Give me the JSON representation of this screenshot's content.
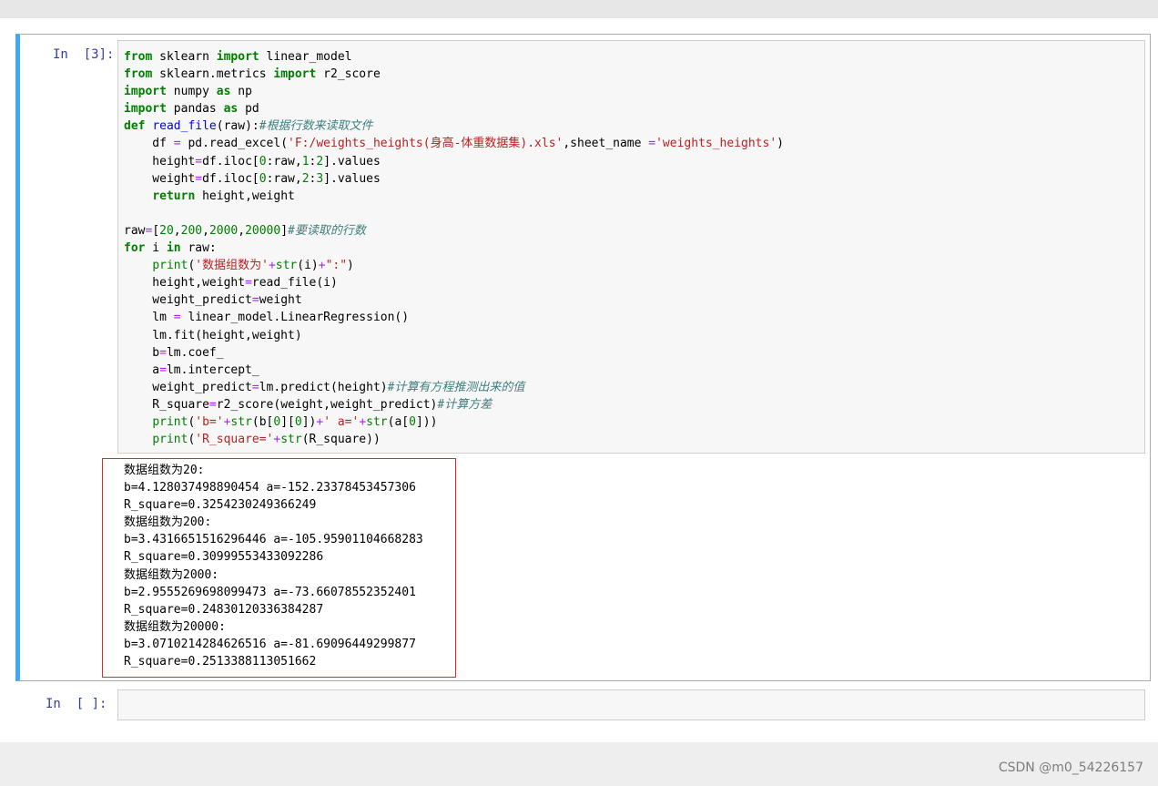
{
  "cell1": {
    "prompt": "In  [3]:",
    "code_lines": [
      [
        {
          "t": "kw",
          "v": "from"
        },
        {
          "t": "",
          "v": " sklearn "
        },
        {
          "t": "kw",
          "v": "import"
        },
        {
          "t": "",
          "v": " linear_model"
        }
      ],
      [
        {
          "t": "kw",
          "v": "from"
        },
        {
          "t": "",
          "v": " sklearn.metrics "
        },
        {
          "t": "kw",
          "v": "import"
        },
        {
          "t": "",
          "v": " r2_score"
        }
      ],
      [
        {
          "t": "kw",
          "v": "import"
        },
        {
          "t": "",
          "v": " numpy "
        },
        {
          "t": "kw",
          "v": "as"
        },
        {
          "t": "",
          "v": " np"
        }
      ],
      [
        {
          "t": "kw",
          "v": "import"
        },
        {
          "t": "",
          "v": " pandas "
        },
        {
          "t": "kw",
          "v": "as"
        },
        {
          "t": "",
          "v": " pd"
        }
      ],
      [
        {
          "t": "kw",
          "v": "def"
        },
        {
          "t": "",
          "v": " "
        },
        {
          "t": "fn",
          "v": "read_file"
        },
        {
          "t": "",
          "v": "(raw):"
        },
        {
          "t": "cm",
          "v": "#根据行数来读取文件"
        }
      ],
      [
        {
          "t": "",
          "v": "    df "
        },
        {
          "t": "op",
          "v": "="
        },
        {
          "t": "",
          "v": " pd.read_excel("
        },
        {
          "t": "str",
          "v": "'F:/weights_heights(身高-体重数据集).xls'"
        },
        {
          "t": "",
          "v": ",sheet_name "
        },
        {
          "t": "op",
          "v": "="
        },
        {
          "t": "str",
          "v": "'weights_heights'"
        },
        {
          "t": "",
          "v": ")"
        }
      ],
      [
        {
          "t": "",
          "v": "    height"
        },
        {
          "t": "op",
          "v": "="
        },
        {
          "t": "",
          "v": "df.iloc["
        },
        {
          "t": "num",
          "v": "0"
        },
        {
          "t": "",
          "v": ":raw,"
        },
        {
          "t": "num",
          "v": "1"
        },
        {
          "t": "",
          "v": ":"
        },
        {
          "t": "num",
          "v": "2"
        },
        {
          "t": "",
          "v": "].values"
        }
      ],
      [
        {
          "t": "",
          "v": "    weight"
        },
        {
          "t": "op",
          "v": "="
        },
        {
          "t": "",
          "v": "df.iloc["
        },
        {
          "t": "num",
          "v": "0"
        },
        {
          "t": "",
          "v": ":raw,"
        },
        {
          "t": "num",
          "v": "2"
        },
        {
          "t": "",
          "v": ":"
        },
        {
          "t": "num",
          "v": "3"
        },
        {
          "t": "",
          "v": "].values"
        }
      ],
      [
        {
          "t": "",
          "v": "    "
        },
        {
          "t": "kw",
          "v": "return"
        },
        {
          "t": "",
          "v": " height,weight"
        }
      ],
      [
        {
          "t": "",
          "v": ""
        }
      ],
      [
        {
          "t": "",
          "v": "raw"
        },
        {
          "t": "op",
          "v": "="
        },
        {
          "t": "",
          "v": "["
        },
        {
          "t": "num",
          "v": "20"
        },
        {
          "t": "",
          "v": ","
        },
        {
          "t": "num",
          "v": "200"
        },
        {
          "t": "",
          "v": ","
        },
        {
          "t": "num",
          "v": "2000"
        },
        {
          "t": "",
          "v": ","
        },
        {
          "t": "num",
          "v": "20000"
        },
        {
          "t": "",
          "v": "]"
        },
        {
          "t": "cm",
          "v": "#要读取的行数"
        }
      ],
      [
        {
          "t": "kw",
          "v": "for"
        },
        {
          "t": "",
          "v": " i "
        },
        {
          "t": "kw",
          "v": "in"
        },
        {
          "t": "",
          "v": " raw:"
        }
      ],
      [
        {
          "t": "",
          "v": "    "
        },
        {
          "t": "bi",
          "v": "print"
        },
        {
          "t": "",
          "v": "("
        },
        {
          "t": "str",
          "v": "'数据组数为'"
        },
        {
          "t": "op",
          "v": "+"
        },
        {
          "t": "bi",
          "v": "str"
        },
        {
          "t": "",
          "v": "(i)"
        },
        {
          "t": "op",
          "v": "+"
        },
        {
          "t": "str",
          "v": "\":\""
        },
        {
          "t": "",
          "v": ")"
        }
      ],
      [
        {
          "t": "",
          "v": "    height,weight"
        },
        {
          "t": "op",
          "v": "="
        },
        {
          "t": "",
          "v": "read_file(i)"
        }
      ],
      [
        {
          "t": "",
          "v": "    weight_predict"
        },
        {
          "t": "op",
          "v": "="
        },
        {
          "t": "",
          "v": "weight"
        }
      ],
      [
        {
          "t": "",
          "v": "    lm "
        },
        {
          "t": "op",
          "v": "="
        },
        {
          "t": "",
          "v": " linear_model.LinearRegression()"
        }
      ],
      [
        {
          "t": "",
          "v": "    lm.fit(height,weight)"
        }
      ],
      [
        {
          "t": "",
          "v": "    b"
        },
        {
          "t": "op",
          "v": "="
        },
        {
          "t": "",
          "v": "lm.coef_"
        }
      ],
      [
        {
          "t": "",
          "v": "    a"
        },
        {
          "t": "op",
          "v": "="
        },
        {
          "t": "",
          "v": "lm.intercept_"
        }
      ],
      [
        {
          "t": "",
          "v": "    weight_predict"
        },
        {
          "t": "op",
          "v": "="
        },
        {
          "t": "",
          "v": "lm.predict(height)"
        },
        {
          "t": "cm",
          "v": "#计算有方程推测出来的值"
        }
      ],
      [
        {
          "t": "",
          "v": "    R_square"
        },
        {
          "t": "op",
          "v": "="
        },
        {
          "t": "",
          "v": "r2_score(weight,weight_predict)"
        },
        {
          "t": "cm",
          "v": "#计算方差"
        }
      ],
      [
        {
          "t": "",
          "v": "    "
        },
        {
          "t": "bi",
          "v": "print"
        },
        {
          "t": "",
          "v": "("
        },
        {
          "t": "str",
          "v": "'b='"
        },
        {
          "t": "op",
          "v": "+"
        },
        {
          "t": "bi",
          "v": "str"
        },
        {
          "t": "",
          "v": "(b["
        },
        {
          "t": "num",
          "v": "0"
        },
        {
          "t": "",
          "v": "]["
        },
        {
          "t": "num",
          "v": "0"
        },
        {
          "t": "",
          "v": "])"
        },
        {
          "t": "op",
          "v": "+"
        },
        {
          "t": "str",
          "v": "' a='"
        },
        {
          "t": "op",
          "v": "+"
        },
        {
          "t": "bi",
          "v": "str"
        },
        {
          "t": "",
          "v": "(a["
        },
        {
          "t": "num",
          "v": "0"
        },
        {
          "t": "",
          "v": "]))"
        }
      ],
      [
        {
          "t": "",
          "v": "    "
        },
        {
          "t": "bi",
          "v": "print"
        },
        {
          "t": "",
          "v": "("
        },
        {
          "t": "str",
          "v": "'R_square='"
        },
        {
          "t": "op",
          "v": "+"
        },
        {
          "t": "bi",
          "v": "str"
        },
        {
          "t": "",
          "v": "(R_square))"
        }
      ]
    ],
    "output_lines": [
      "数据组数为20:",
      "b=4.128037498890454 a=-152.23378453457306",
      "R_square=0.3254230249366249",
      "数据组数为200:",
      "b=3.4316651516296446 a=-105.95901104668283",
      "R_square=0.30999553433092286",
      "数据组数为2000:",
      "b=2.9555269698099473 a=-73.66078552352401",
      "R_square=0.24830120336384287",
      "数据组数为20000:",
      "b=3.0710214284626516 a=-81.69096449299877",
      "R_square=0.2513388113051662"
    ]
  },
  "cell2": {
    "prompt": "In  [ ]:"
  },
  "watermark": "CSDN @m0_54226157",
  "colors": {
    "selected_border": "#42a5f5",
    "prompt": "#303f9f",
    "keyword": "#008000",
    "string": "#ba2121",
    "comment": "#408080",
    "function": "#0000ff",
    "operator": "#aa22ff",
    "output_highlight": "#d32f2f"
  }
}
